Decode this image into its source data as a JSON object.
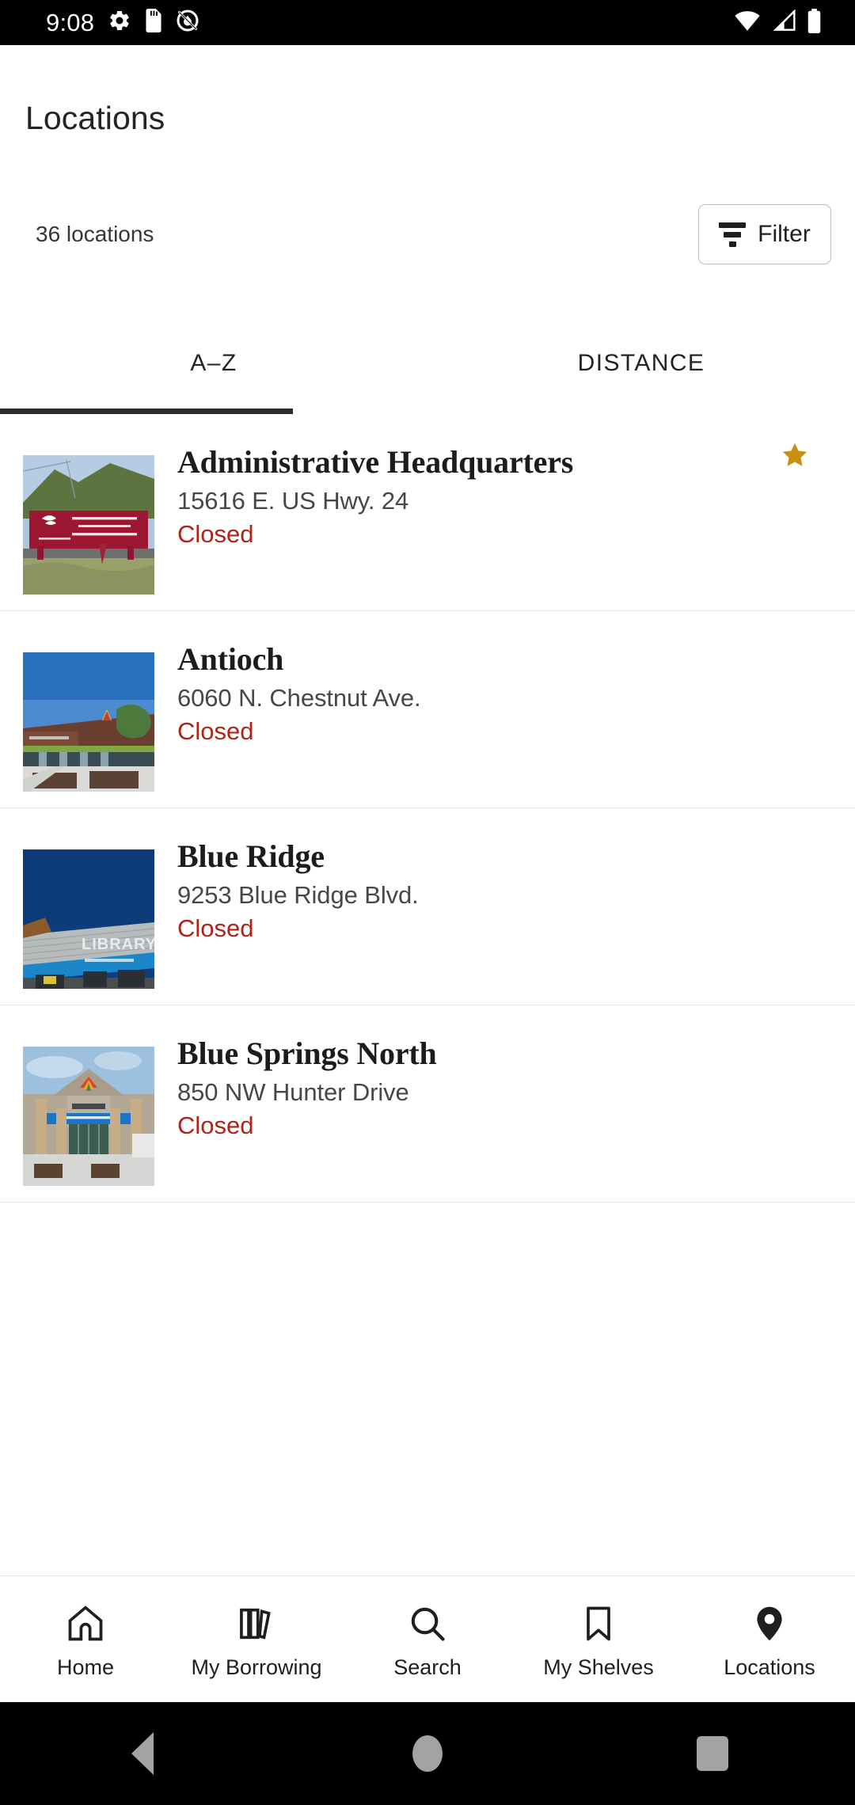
{
  "status_bar": {
    "time": "9:08",
    "left_icons": [
      "gear-icon",
      "sd-card-icon",
      "do-not-disturb-icon"
    ],
    "right_icons": [
      "wifi-icon",
      "cell-signal-icon",
      "battery-icon"
    ]
  },
  "header": {
    "title": "Locations"
  },
  "summary": {
    "count_label": "36 locations",
    "filter_label": "Filter"
  },
  "tabs": [
    {
      "label": "A–Z",
      "active": true
    },
    {
      "label": "DISTANCE",
      "active": false
    }
  ],
  "locations": [
    {
      "name": "Administrative Headquarters",
      "address": "15616 E. US Hwy. 24",
      "status": "Closed",
      "favorite": true,
      "thumbnail": "mcpl-administrative-headquarters-sign"
    },
    {
      "name": "Antioch",
      "address": "6060 N. Chestnut Ave.",
      "status": "Closed",
      "favorite": false,
      "thumbnail": "antioch-branch-exterior"
    },
    {
      "name": "Blue Ridge",
      "address": "9253 Blue Ridge Blvd.",
      "status": "Closed",
      "favorite": false,
      "thumbnail": "blue-ridge-branch-exterior"
    },
    {
      "name": "Blue Springs North",
      "address": "850 NW Hunter Drive",
      "status": "Closed",
      "favorite": false,
      "thumbnail": "blue-springs-north-branch-exterior"
    }
  ],
  "bottom_nav": [
    {
      "label": "Home",
      "icon": "home-icon",
      "active": false
    },
    {
      "label": "My Borrowing",
      "icon": "books-icon",
      "active": false
    },
    {
      "label": "Search",
      "icon": "search-icon",
      "active": false
    },
    {
      "label": "My Shelves",
      "icon": "bookmark-icon",
      "active": false
    },
    {
      "label": "Locations",
      "icon": "map-pin-icon",
      "active": true
    }
  ],
  "system_nav": [
    "back-button",
    "home-button",
    "recents-button"
  ],
  "colors": {
    "status_closed": "#af2318",
    "favorite_star": "#c8900e",
    "tab_indicator": "#2b2b2b",
    "text_primary": "#1a1c1e",
    "text_secondary": "#45484b"
  }
}
